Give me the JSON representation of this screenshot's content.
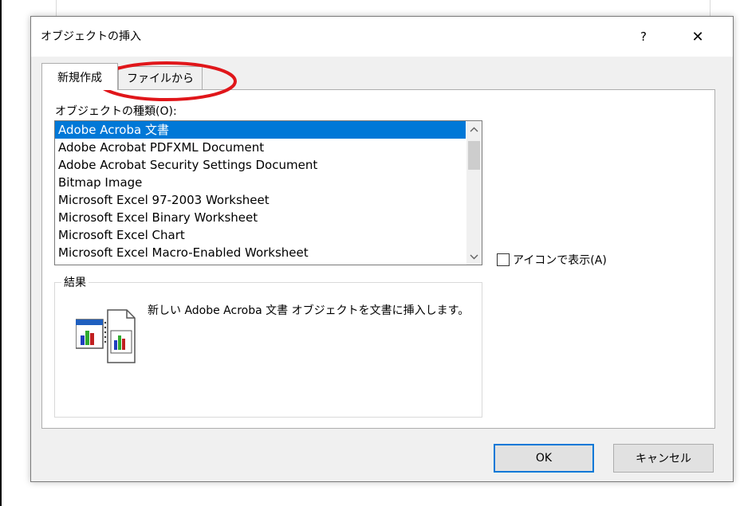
{
  "dialog": {
    "title": "オブジェクトの挿入",
    "help_label": "?",
    "close_label": "✕"
  },
  "tabs": [
    {
      "label": "新規作成",
      "active": true
    },
    {
      "label": "ファイルから",
      "active": false
    }
  ],
  "object_type": {
    "label": "オブジェクトの種類(O):",
    "items": [
      "Adobe Acroba 文書",
      "Adobe Acrobat PDFXML Document",
      "Adobe Acrobat Security Settings Document",
      "Bitmap Image",
      "Microsoft Excel 97-2003 Worksheet",
      "Microsoft Excel Binary Worksheet",
      "Microsoft Excel Chart",
      "Microsoft Excel Macro-Enabled Worksheet"
    ],
    "selected_index": 0
  },
  "display_as_icon": {
    "label": "アイコンで表示(A)",
    "checked": false
  },
  "result": {
    "legend": "結果",
    "text": "新しい Adobe Acroba 文書 オブジェクトを文書に挿入します。"
  },
  "buttons": {
    "ok": "OK",
    "cancel": "キャンセル"
  },
  "colors": {
    "selection": "#0078d7",
    "annotation": "#e0161a"
  }
}
